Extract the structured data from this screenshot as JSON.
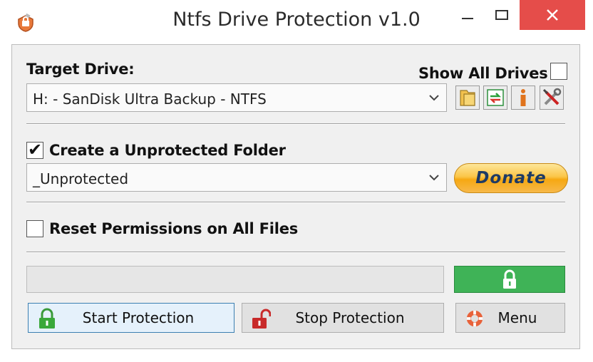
{
  "window": {
    "title": "Ntfs Drive Protection v1.0",
    "close_icon": "close-icon",
    "accent_close": "#e54d4a"
  },
  "target": {
    "label": "Target Drive:",
    "show_all_label": "Show All Drives",
    "show_all_checked": false,
    "drive_value": "H: - SanDisk Ultra Backup - NTFS"
  },
  "tools": {
    "icons": [
      "folder-icon",
      "refresh-icon",
      "info-icon",
      "tools-icon"
    ]
  },
  "unprotected": {
    "label": "Create a Unprotected Folder",
    "checked": true,
    "folder_value": "_Unprotected"
  },
  "donate": {
    "label": "Donate"
  },
  "reset": {
    "label": "Reset Permissions on All Files",
    "checked": false
  },
  "status": {
    "lock_color": "#3fb357"
  },
  "buttons": {
    "start_label": "Start Protection",
    "stop_label": "Stop Protection",
    "menu_label": "Menu"
  }
}
